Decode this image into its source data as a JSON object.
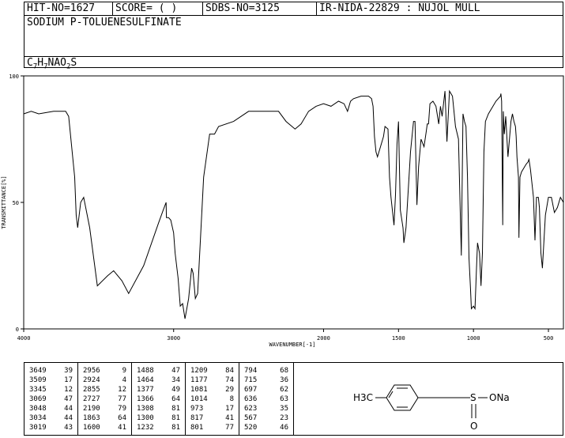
{
  "header": {
    "hit_no": "HIT-NO=1627",
    "score": "SCORE=  (   )",
    "sdbs_no": "SDBS-NO=3125",
    "ir_nida": "IR-NIDA-22829 : NUJOL MULL",
    "compound_name": "SODIUM P-TOLUENESULFINATE",
    "formula_parts": [
      "C",
      "7",
      "H",
      "7",
      "NAO",
      "2",
      "S"
    ]
  },
  "chart_data": {
    "type": "line",
    "xlabel": "WAVENUMBER[-1]",
    "ylabel": "TRANSMITTANCE[%]",
    "xlim": [
      4000,
      400
    ],
    "ylim": [
      0,
      100
    ],
    "x_ticks": [
      4000,
      3000,
      2000,
      1500,
      1000,
      500
    ],
    "y_ticks": [
      0,
      50,
      100
    ],
    "x": [
      4000,
      3950,
      3900,
      3800,
      3720,
      3700,
      3660,
      3650,
      3640,
      3620,
      3600,
      3560,
      3509,
      3440,
      3400,
      3345,
      3300,
      3200,
      3100,
      3069,
      3050,
      3048,
      3034,
      3019,
      3000,
      2990,
      2970,
      2956,
      2940,
      2924,
      2900,
      2880,
      2870,
      2855,
      2840,
      2800,
      2760,
      2727,
      2700,
      2600,
      2500,
      2400,
      2300,
      2250,
      2190,
      2150,
      2100,
      2050,
      2000,
      1950,
      1900,
      1863,
      1840,
      1820,
      1800,
      1750,
      1700,
      1680,
      1670,
      1660,
      1650,
      1640,
      1620,
      1600,
      1590,
      1570,
      1560,
      1550,
      1530,
      1520,
      1510,
      1500,
      1488,
      1470,
      1464,
      1450,
      1420,
      1400,
      1390,
      1377,
      1366,
      1350,
      1330,
      1315,
      1308,
      1300,
      1290,
      1270,
      1250,
      1232,
      1220,
      1209,
      1190,
      1177,
      1160,
      1140,
      1120,
      1100,
      1081,
      1070,
      1060,
      1050,
      1040,
      1030,
      1020,
      1014,
      1000,
      990,
      980,
      973,
      960,
      950,
      940,
      930,
      920,
      900,
      850,
      820,
      817,
      812,
      805,
      801,
      797,
      794,
      785,
      770,
      750,
      740,
      730,
      720,
      715,
      710,
      700,
      697,
      690,
      680,
      660,
      650,
      636,
      630,
      620,
      600,
      590,
      580,
      567,
      560,
      550,
      540,
      520,
      500,
      480,
      460,
      440,
      420,
      400
    ],
    "y": [
      85,
      86,
      85,
      86,
      86,
      84,
      60,
      45,
      40,
      50,
      52,
      40,
      17,
      21,
      23,
      19,
      14,
      25,
      42,
      47,
      50,
      44,
      44,
      43,
      38,
      30,
      20,
      9,
      10,
      4,
      12,
      24,
      22,
      12,
      14,
      60,
      77,
      77,
      80,
      82,
      86,
      86,
      86,
      82,
      79,
      81,
      86,
      88,
      89,
      88,
      90,
      89,
      86,
      90,
      91,
      92,
      92,
      91,
      88,
      76,
      70,
      68,
      72,
      76,
      80,
      79,
      60,
      52,
      41,
      53,
      73,
      82,
      47,
      40,
      34,
      40,
      70,
      82,
      82,
      49,
      64,
      75,
      72,
      78,
      81,
      81,
      89,
      90,
      88,
      81,
      88,
      84,
      94,
      74,
      94,
      92,
      80,
      75,
      29,
      85,
      82,
      80,
      60,
      28,
      16,
      8,
      9,
      8,
      24,
      34,
      30,
      17,
      30,
      70,
      82,
      85,
      90,
      92,
      93,
      90,
      41,
      86,
      80,
      77,
      84,
      68,
      82,
      85,
      82,
      80,
      76,
      68,
      60,
      36,
      60,
      62,
      64,
      65,
      66,
      67,
      63,
      52,
      35,
      52,
      52,
      48,
      30,
      24,
      45,
      52,
      52,
      46,
      48,
      52,
      50,
      45,
      38,
      36
    ]
  },
  "peak_table": {
    "columns": [
      [
        [
          "3649",
          "39"
        ],
        [
          "3509",
          "17"
        ],
        [
          "3345",
          "12"
        ],
        [
          "3069",
          "47"
        ],
        [
          "3048",
          "44"
        ],
        [
          "3034",
          "44"
        ],
        [
          "3019",
          "43"
        ]
      ],
      [
        [
          "2956",
          "9"
        ],
        [
          "2924",
          "4"
        ],
        [
          "2855",
          "12"
        ],
        [
          "2727",
          "77"
        ],
        [
          "2190",
          "79"
        ],
        [
          "1863",
          "64"
        ],
        [
          "1600",
          "41"
        ]
      ],
      [
        [
          "1488",
          "47"
        ],
        [
          "1464",
          "34"
        ],
        [
          "1377",
          "49"
        ],
        [
          "1366",
          "64"
        ],
        [
          "1308",
          "81"
        ],
        [
          "1300",
          "81"
        ],
        [
          "1232",
          "81"
        ]
      ],
      [
        [
          "1209",
          "84"
        ],
        [
          "1177",
          "74"
        ],
        [
          "1081",
          "29"
        ],
        [
          "1014",
          "8"
        ],
        [
          "973",
          "17"
        ],
        [
          "817",
          "41"
        ],
        [
          "801",
          "77"
        ]
      ],
      [
        [
          "794",
          "68"
        ],
        [
          "715",
          "36"
        ],
        [
          "697",
          "62"
        ],
        [
          "636",
          "63"
        ],
        [
          "623",
          "35"
        ],
        [
          "567",
          "23"
        ],
        [
          "520",
          "46"
        ]
      ]
    ]
  },
  "structure": {
    "methyl": "H3C",
    "sulfur": "S",
    "oxygen_na": "ONa",
    "oxygen": "O"
  }
}
